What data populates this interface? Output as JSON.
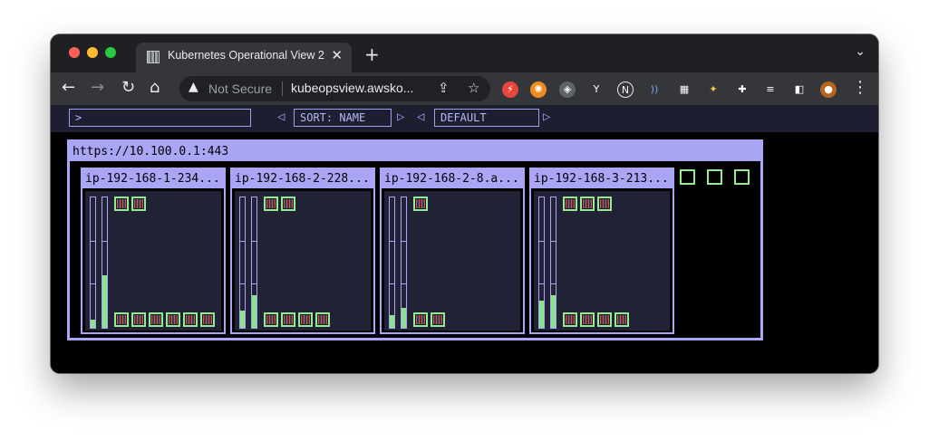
{
  "browser": {
    "tab_title": "Kubernetes Operational View 2",
    "tab_close": "✕",
    "new_tab": "+",
    "tab_menu": "⌄",
    "nav": {
      "back": "←",
      "forward": "→",
      "reload": "↻",
      "home": "⌂"
    },
    "security_label": "Not Secure",
    "warning_glyph": "▲",
    "url": "kubeopsview.awsko...",
    "share_glyph": "⇪",
    "star_glyph": "☆",
    "menu_glyph": "⋮",
    "extensions": [
      "⚡",
      "✺",
      "◈",
      "Y",
      "N",
      "))",
      "▦",
      "✦",
      "✚",
      "≡",
      "◧",
      "●"
    ]
  },
  "kube": {
    "filter_value": ">",
    "prev_glyph": "◁",
    "next_glyph": "▷",
    "sort_label": "SORT: NAME",
    "theme_label": "DEFAULT",
    "cluster_url": "https://10.100.0.1:443",
    "nodes": [
      {
        "name": "ip-192-168-1-234...",
        "cpu": 0.06,
        "mem": 0.4,
        "top_pods": 2,
        "bottom_pods": 6
      },
      {
        "name": "ip-192-168-2-228...",
        "cpu": 0.13,
        "mem": 0.25,
        "top_pods": 2,
        "bottom_pods": 4
      },
      {
        "name": "ip-192-168-2-8.a...",
        "cpu": 0.1,
        "mem": 0.15,
        "top_pods": 1,
        "bottom_pods": 2
      },
      {
        "name": "ip-192-168-3-213...",
        "cpu": 0.21,
        "mem": 0.25,
        "top_pods": 3,
        "bottom_pods": 4
      }
    ],
    "unassigned_pods": 3
  },
  "colors": {
    "node_border": "#aaa6f5",
    "pod_border": "#90ee90",
    "gauge_fill": "#8be38b",
    "node_bg": "#222236"
  }
}
